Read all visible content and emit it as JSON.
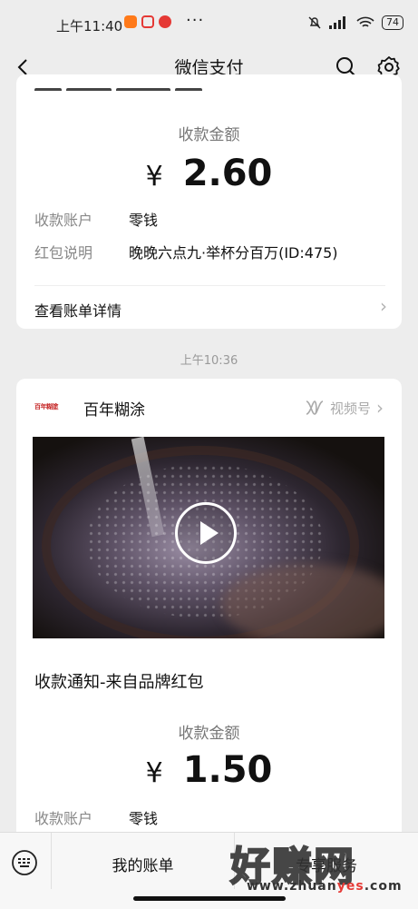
{
  "status_bar": {
    "time": "上午11:40",
    "more": "···",
    "battery": "74"
  },
  "nav": {
    "title": "微信支付"
  },
  "card1": {
    "amount_label": "收款金额",
    "currency": "¥",
    "amount": "2.60",
    "rows": [
      {
        "label": "收款账户",
        "value": "零钱"
      },
      {
        "label": "红包说明",
        "value": "晚晚六点九·举杯分百万(ID:475)"
      }
    ],
    "detail_link": "查看账单详情"
  },
  "timestamp": "上午10:36",
  "card2": {
    "brand_logo_text": "百年糊塗",
    "brand_name": "百年糊涂",
    "channels_label": "视频号",
    "notice_title": "收款通知-来自品牌红包",
    "amount_label": "收款金额",
    "currency": "¥",
    "amount": "1.50",
    "rows": [
      {
        "label": "收款账户",
        "value": "零钱"
      }
    ]
  },
  "bottom_bar": {
    "menu_1": "我的账单",
    "menu_2": "专享服务"
  },
  "watermark": {
    "cn": "好赚网",
    "url_prefix": "www.zhuan",
    "url_accent": "yes",
    "url_suffix": ".com"
  },
  "colors": {
    "background": "#ededed",
    "card": "#ffffff",
    "label_gray": "#888888",
    "brand_red": "#c62828"
  }
}
